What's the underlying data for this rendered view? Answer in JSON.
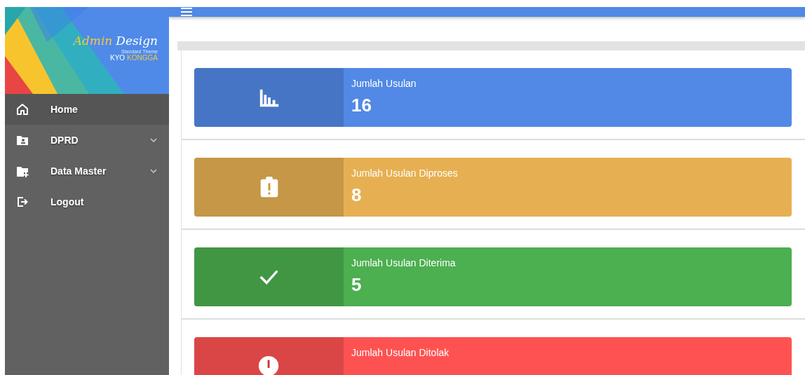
{
  "brand": {
    "word_1": "Admin",
    "word_2": "Design",
    "subtitle": "Standard Theme",
    "owner_1": "KYO",
    "owner_2": "KONGGA"
  },
  "menu": [
    {
      "label": "Home",
      "kind": "home",
      "selected": true
    },
    {
      "label": "DPRD",
      "kind": "group",
      "selected": false,
      "expanded": false
    },
    {
      "label": "Data Master",
      "kind": "master",
      "selected": false,
      "expanded": false
    },
    {
      "label": "Logout",
      "kind": "logout",
      "selected": false
    }
  ],
  "stats": [
    {
      "kind": "chart",
      "label": "Jumlah Usulan",
      "value": "16",
      "color": "#5289e6"
    },
    {
      "kind": "clipboard",
      "label": "Jumlah Usulan Diproses",
      "value": "8",
      "color": "#e6b052"
    },
    {
      "kind": "check",
      "label": "Jumlah Usulan Diterima",
      "value": "5",
      "color": "#4caf50"
    },
    {
      "kind": "alert",
      "label": "Jumlah Usulan Ditolak",
      "color": "#fe5252"
    }
  ]
}
